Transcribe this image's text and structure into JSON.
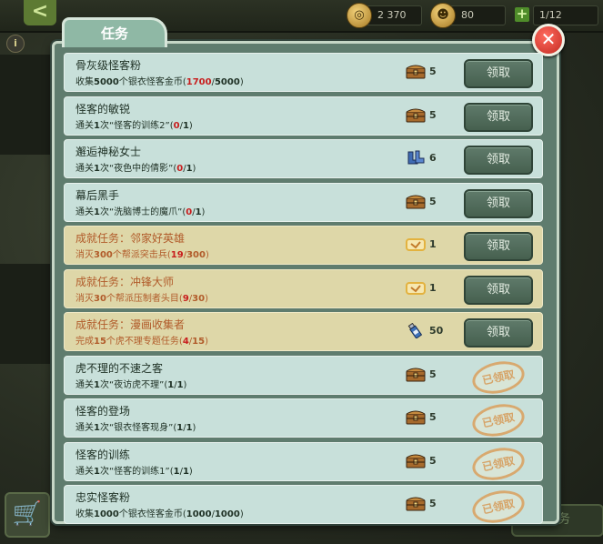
{
  "topbar": {
    "back_glyph": "<",
    "resources": [
      {
        "icon": "coin-icon",
        "glyph": "◎",
        "value": "2 370"
      },
      {
        "icon": "grin-face-icon",
        "glyph": "☻",
        "value": "80"
      },
      {
        "icon": "plus-icon",
        "glyph": "",
        "value": "1/12"
      }
    ]
  },
  "panel": {
    "tab_label": "任务",
    "close_glyph": "✕"
  },
  "reward_icons": {
    "chest": {
      "color": "#a66a2c"
    },
    "boots": {
      "color": "#3f6bb3"
    },
    "ticket": {
      "color": "#e3b23f"
    },
    "bottle": {
      "color": "#3f72b8"
    }
  },
  "tasks": [
    {
      "title": "骨灰级怪客粉",
      "desc_pre": "收集",
      "desc_num": "5000",
      "desc_mid": "个银衣怪客金币(",
      "prog_cur": "1700",
      "prog_sep": "/",
      "prog_total": "5000",
      "desc_end": ")",
      "reward_icon": "chest-icon",
      "qty": "5",
      "state": "claim",
      "btn": "领取",
      "style": "normal"
    },
    {
      "title": "怪客的敏锐",
      "desc_pre": "通关",
      "desc_num": "1",
      "desc_mid": "次“怪客的训练2”(",
      "prog_cur": "0",
      "prog_sep": "/",
      "prog_total": "1",
      "desc_end": ")",
      "reward_icon": "chest-icon",
      "qty": "5",
      "state": "claim",
      "btn": "领取",
      "style": "normal"
    },
    {
      "title": "邂逅神秘女士",
      "desc_pre": "通关",
      "desc_num": "1",
      "desc_mid": "次“夜色中的倩影”(",
      "prog_cur": "0",
      "prog_sep": "/",
      "prog_total": "1",
      "desc_end": ")",
      "reward_icon": "boots-icon",
      "qty": "6",
      "state": "claim",
      "btn": "领取",
      "style": "normal"
    },
    {
      "title": "幕后黑手",
      "desc_pre": "通关",
      "desc_num": "1",
      "desc_mid": "次“洗脑博士的魔爪”(",
      "prog_cur": "0",
      "prog_sep": "/",
      "prog_total": "1",
      "desc_end": ")",
      "reward_icon": "chest-icon",
      "qty": "5",
      "state": "claim",
      "btn": "领取",
      "style": "normal"
    },
    {
      "title": "成就任务：邻家好英雄",
      "desc_pre": "消灭",
      "desc_num": "300",
      "desc_mid": "个帮派突击兵(",
      "prog_cur": "19",
      "prog_sep": "/",
      "prog_total": "300",
      "desc_end": ")",
      "reward_icon": "ticket-icon",
      "qty": "1",
      "state": "claim",
      "btn": "领取",
      "style": "gold"
    },
    {
      "title": "成就任务：冲锋大师",
      "desc_pre": "消灭",
      "desc_num": "30",
      "desc_mid": "个帮派压制者头目(",
      "prog_cur": "9",
      "prog_sep": "/",
      "prog_total": "30",
      "desc_end": ")",
      "reward_icon": "ticket-icon",
      "qty": "1",
      "state": "claim",
      "btn": "领取",
      "style": "gold"
    },
    {
      "title": "成就任务：漫画收集者",
      "desc_pre": "完成",
      "desc_num": "15",
      "desc_mid": "个虎不理专题任务(",
      "prog_cur": "4",
      "prog_sep": "/",
      "prog_total": "15",
      "desc_end": ")",
      "reward_icon": "bottle-icon",
      "qty": "50",
      "state": "claim",
      "btn": "领取",
      "style": "gold"
    },
    {
      "title": "虎不理的不速之客",
      "desc_pre": "通关",
      "desc_num": "1",
      "desc_mid": "次“夜访虎不理”(",
      "prog_cur": "1",
      "prog_sep": "/",
      "prog_total": "1",
      "desc_end": ")",
      "reward_icon": "chest-icon",
      "qty": "5",
      "state": "claimed",
      "btn": "已领取",
      "style": "normal"
    },
    {
      "title": "怪客的登场",
      "desc_pre": "通关",
      "desc_num": "1",
      "desc_mid": "次“银衣怪客现身”(",
      "prog_cur": "1",
      "prog_sep": "/",
      "prog_total": "1",
      "desc_end": ")",
      "reward_icon": "chest-icon",
      "qty": "5",
      "state": "claimed",
      "btn": "已领取",
      "style": "normal"
    },
    {
      "title": "怪客的训练",
      "desc_pre": "通关",
      "desc_num": "1",
      "desc_mid": "次“怪客的训练1”(",
      "prog_cur": "1",
      "prog_sep": "/",
      "prog_total": "1",
      "desc_end": ")",
      "reward_icon": "chest-icon",
      "qty": "5",
      "state": "claimed",
      "btn": "已领取",
      "style": "normal"
    },
    {
      "title": "忠实怪客粉",
      "desc_pre": "收集",
      "desc_num": "1000",
      "desc_mid": "个银衣怪客金币(",
      "prog_cur": "1000",
      "prog_sep": "/",
      "prog_total": "1000",
      "desc_end": ")",
      "reward_icon": "chest-icon",
      "qty": "5",
      "state": "claimed",
      "btn": "已领取",
      "style": "normal"
    }
  ],
  "bottom": {
    "cart_glyph": "🛒",
    "tab_label": "任务"
  },
  "misc": {
    "info_glyph": "i"
  }
}
